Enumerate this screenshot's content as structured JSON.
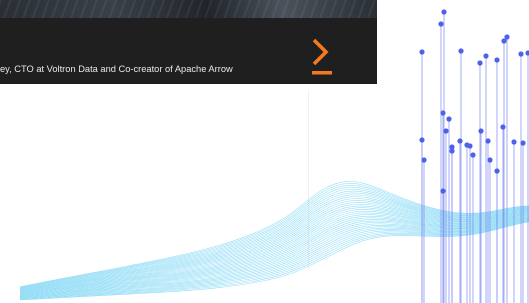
{
  "promo_card": {
    "caption": "ey, CTO at Voltron Data and Co-creator of Apache Arrow",
    "next_icon": "chevron-right-icon",
    "accent_color": "#f47a20",
    "background_color": "#1f1f1f"
  },
  "decor": {
    "icon": "data-network-illustration",
    "node_color": "#4d62e8",
    "line_color": "#7a84ef",
    "wave_color": "#3dc2ef"
  }
}
